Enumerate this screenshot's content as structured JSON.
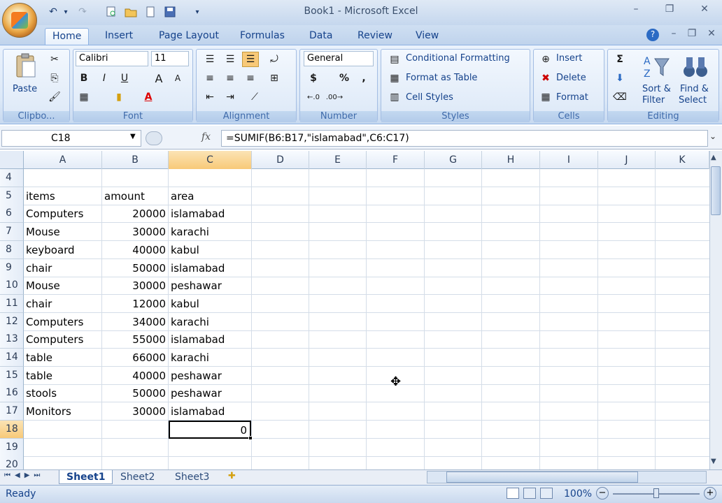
{
  "window": {
    "title": "Book1 - Microsoft Excel"
  },
  "quick_access": {
    "undo": "↶",
    "redo": "↷",
    "dropdown": "▾"
  },
  "tabs": [
    "Home",
    "Insert",
    "Page Layout",
    "Formulas",
    "Data",
    "Review",
    "View"
  ],
  "ribbon": {
    "clipboard": {
      "paste": "Paste",
      "label": "Clipbo..."
    },
    "font": {
      "name": "Calibri",
      "size": "11",
      "bold": "B",
      "italic": "I",
      "underline": "U",
      "grow": "A",
      "shrink": "A",
      "label": "Font"
    },
    "alignment": {
      "label": "Alignment"
    },
    "number": {
      "format": "General",
      "currency": "$",
      "percent": "%",
      "comma": ",",
      "label": "Number"
    },
    "styles": {
      "conditional": "Conditional Formatting",
      "format_table": "Format as Table",
      "cell_styles": "Cell Styles",
      "label": "Styles"
    },
    "cells": {
      "insert": "Insert",
      "delete": "Delete",
      "format": "Format",
      "label": "Cells"
    },
    "editing": {
      "sigma": "Σ",
      "sort1": "Sort &",
      "sort2": "Filter",
      "find1": "Find &",
      "find2": "Select",
      "label": "Editing"
    }
  },
  "formula_bar": {
    "name_box": "C18",
    "fx": "fx",
    "formula": "=SUMIF(B6:B17,\"islamabad\",C6:C17)"
  },
  "columns": [
    "A",
    "B",
    "C",
    "D",
    "E",
    "F",
    "G",
    "H",
    "I",
    "J",
    "K"
  ],
  "rows": [
    {
      "num": "4",
      "a": "",
      "b": "",
      "c": ""
    },
    {
      "num": "5",
      "a": "items",
      "b": "amount",
      "c": "area"
    },
    {
      "num": "6",
      "a": "Computers",
      "b": "20000",
      "c": "islamabad"
    },
    {
      "num": "7",
      "a": "Mouse",
      "b": "30000",
      "c": "karachi"
    },
    {
      "num": "8",
      "a": "keyboard",
      "b": "40000",
      "c": "kabul"
    },
    {
      "num": "9",
      "a": "chair",
      "b": "50000",
      "c": "islamabad"
    },
    {
      "num": "10",
      "a": "Mouse",
      "b": "30000",
      "c": "peshawar"
    },
    {
      "num": "11",
      "a": "chair",
      "b": "12000",
      "c": "kabul"
    },
    {
      "num": "12",
      "a": "Computers",
      "b": "34000",
      "c": "karachi"
    },
    {
      "num": "13",
      "a": "Computers",
      "b": "55000",
      "c": "islamabad"
    },
    {
      "num": "14",
      "a": "table",
      "b": "66000",
      "c": "karachi"
    },
    {
      "num": "15",
      "a": "table",
      "b": "40000",
      "c": "peshawar"
    },
    {
      "num": "16",
      "a": "stools",
      "b": "50000",
      "c": "peshawar"
    },
    {
      "num": "17",
      "a": "Monitors",
      "b": "30000",
      "c": "islamabad"
    },
    {
      "num": "18",
      "a": "",
      "b": "",
      "c": "0"
    },
    {
      "num": "19",
      "a": "",
      "b": "",
      "c": ""
    },
    {
      "num": "20",
      "a": "",
      "b": "",
      "c": ""
    }
  ],
  "sheets": [
    "Sheet1",
    "Sheet2",
    "Sheet3"
  ],
  "status": {
    "text": "Ready",
    "zoom": "100%"
  },
  "colors": {
    "accent": "#15428b",
    "selected_header": "#f8c978"
  }
}
